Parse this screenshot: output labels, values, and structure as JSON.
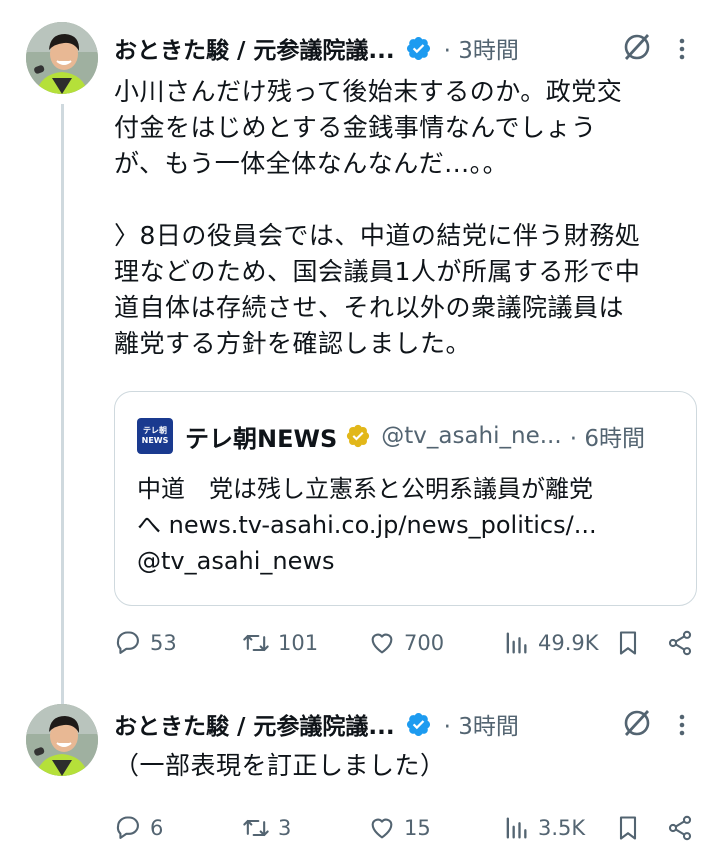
{
  "tweets": [
    {
      "author": "おときた駿 / 元参議院議...",
      "time": "3時間",
      "lines": [
        "小川さんだけ残って後始末するのか。政党交",
        "付金をはじめとする金銭事情なんでしょう",
        "が、もう一体全体なんなんだ...。。",
        "",
        "〉8日の役員会では、中道の結党に伴う財務処",
        "理などのため、国会議員1人が所属する形で中",
        "道自体は存続させ、それ以外の衆議院議員は",
        "離党する方針を確認しました。"
      ],
      "quote": {
        "logo_line1": "テレ朝",
        "logo_line2": "NEWS",
        "name": "テレ朝NEWS",
        "handle": "@tv_asahi_ne...",
        "time": "6時間",
        "lines": [
          "中道　党は残し立憲系と公明系議員が離党",
          "へ news.tv-asahi.co.jp/news_politics/...",
          "@tv_asahi_news"
        ]
      },
      "replies": "53",
      "reposts": "101",
      "likes": "700",
      "views": "49.9K"
    },
    {
      "author": "おときた駿 / 元参議院議...",
      "time": "3時間",
      "lines": [
        "（一部表現を訂正しました）"
      ],
      "replies": "6",
      "reposts": "3",
      "likes": "15",
      "views": "3.5K"
    }
  ],
  "colors": {
    "verified": "#1d9bf0",
    "gold_badge": "#e2b719",
    "muted": "#536471",
    "thread_line": "#cfd9de",
    "text": "#0f1419"
  },
  "icons": [
    "verified-badge-icon",
    "grok-icon",
    "more-icon",
    "reply-icon",
    "repost-icon",
    "like-icon",
    "views-icon",
    "bookmark-icon",
    "share-icon"
  ]
}
